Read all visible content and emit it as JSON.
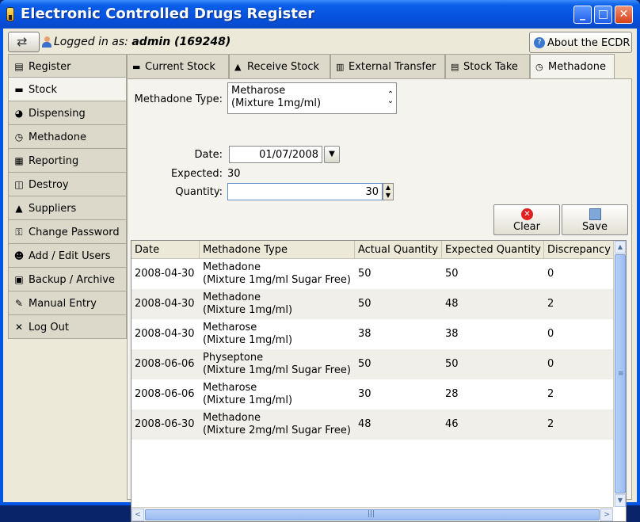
{
  "window": {
    "title": "Electronic Controlled Drugs Register",
    "minimize": "_",
    "maximize": "□",
    "close": "✕"
  },
  "header": {
    "logged_in_prefix": "Logged in as:",
    "user": "admin (169248)",
    "about": "About the ECDR",
    "about_icon_glyph": "?"
  },
  "sidebar": {
    "items": [
      {
        "label": "Register",
        "icon": "register-icon",
        "glyph": "▤"
      },
      {
        "label": "Stock",
        "icon": "truck-icon",
        "glyph": "▬"
      },
      {
        "label": "Dispensing",
        "icon": "pill-icon",
        "glyph": "◕"
      },
      {
        "label": "Methadone",
        "icon": "clock-icon",
        "glyph": "◷"
      },
      {
        "label": "Reporting",
        "icon": "report-icon",
        "glyph": "▦"
      },
      {
        "label": "Destroy",
        "icon": "shredder-icon",
        "glyph": "◫"
      },
      {
        "label": "Suppliers",
        "icon": "supplier-icon",
        "glyph": "▲"
      },
      {
        "label": "Change Password",
        "icon": "lock-icon",
        "glyph": "⚿"
      },
      {
        "label": "Add / Edit Users",
        "icon": "users-icon",
        "glyph": "☻"
      },
      {
        "label": "Backup / Archive",
        "icon": "archive-icon",
        "glyph": "▣"
      },
      {
        "label": "Manual Entry",
        "icon": "manual-entry-icon",
        "glyph": "✎"
      },
      {
        "label": "Log Out",
        "icon": "logout-icon",
        "glyph": "✕"
      }
    ],
    "active": "Stock"
  },
  "tabs": [
    {
      "label": "Current Stock",
      "icon": "truck-icon",
      "glyph": "▬"
    },
    {
      "label": "Receive Stock",
      "icon": "inbox-icon",
      "glyph": "▲"
    },
    {
      "label": "External Transfer",
      "icon": "transfer-icon",
      "glyph": "▥"
    },
    {
      "label": "Stock Take",
      "icon": "clipboard-icon",
      "glyph": "▤"
    },
    {
      "label": "Methadone",
      "icon": "clock-icon",
      "glyph": "◷"
    }
  ],
  "form": {
    "type_label": "Methadone Type:",
    "type_value_line1": "Metharose",
    "type_value_line2": "(Mixture 1mg/ml)",
    "date_label": "Date:",
    "date_value": "01/07/2008",
    "expected_label": "Expected:",
    "expected_value": "30",
    "quantity_label": "Quantity:",
    "quantity_value": "30",
    "clear": "Clear",
    "save": "Save",
    "clear_icon_glyph": "✕"
  },
  "table": {
    "columns": [
      "Date",
      "Methadone Type",
      "Actual Quantity",
      "Expected Quantity",
      "Discrepancy"
    ],
    "rows": [
      {
        "date": "2008-04-30",
        "type1": "Methadone",
        "type2": "(Mixture 1mg/ml Sugar Free)",
        "actual": "50",
        "expected": "50",
        "discrepancy": "0"
      },
      {
        "date": "2008-04-30",
        "type1": "Methadone",
        "type2": "(Mixture 1mg/ml)",
        "actual": "50",
        "expected": "48",
        "discrepancy": "2"
      },
      {
        "date": "2008-04-30",
        "type1": "Metharose",
        "type2": "(Mixture 1mg/ml)",
        "actual": "38",
        "expected": "38",
        "discrepancy": "0"
      },
      {
        "date": "2008-06-06",
        "type1": "Physeptone",
        "type2": "(Mixture 1mg/ml Sugar Free)",
        "actual": "50",
        "expected": "50",
        "discrepancy": "0"
      },
      {
        "date": "2008-06-06",
        "type1": "Metharose",
        "type2": "(Mixture 1mg/ml)",
        "actual": "30",
        "expected": "28",
        "discrepancy": "2"
      },
      {
        "date": "2008-06-30",
        "type1": "Methadone",
        "type2": "(Mixture 2mg/ml Sugar Free)",
        "actual": "48",
        "expected": "46",
        "discrepancy": "2"
      }
    ]
  },
  "glyphs": {
    "up": "▲",
    "down": "▼",
    "left": "<",
    "right": ">",
    "combo_up": "⌃",
    "combo_down": "⌄",
    "dropdown": "▼",
    "grip": "≡",
    "grip_h": "|||"
  }
}
